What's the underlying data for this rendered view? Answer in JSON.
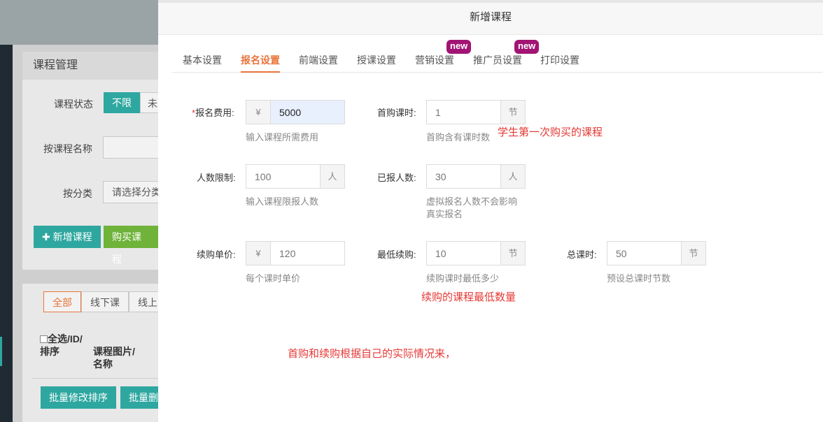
{
  "background": {
    "panel_title": "课程管理",
    "course_status_label": "课程状态",
    "status_options": [
      "不限",
      "未"
    ],
    "name_filter_label": "按课程名称",
    "category_label": "按分类",
    "category_placeholder": "请选择分类",
    "add_course_label": "新增课程",
    "buy_course_label": "购买课程",
    "type_tabs": [
      "全部",
      "线下课",
      "线上"
    ],
    "table_header_col1": "全选/ID/排序",
    "table_header_col2": "课程图片/名称",
    "batch_sort_label": "批量修改排序",
    "batch_delete_label": "批量删"
  },
  "modal": {
    "title": "新增课程",
    "tabs": [
      {
        "label": "基本设置"
      },
      {
        "label": "报名设置",
        "active": true
      },
      {
        "label": "前端设置"
      },
      {
        "label": "授课设置"
      },
      {
        "label": "营销设置",
        "badge": "new"
      },
      {
        "label": "推广员设置",
        "badge": "new"
      },
      {
        "label": "打印设置"
      }
    ],
    "fields": {
      "fee": {
        "required_mark": "*",
        "label": "报名费用:",
        "prefix": "¥",
        "value": "5000",
        "hint": "输入课程所需费用"
      },
      "first_lessons": {
        "label": "首购课时:",
        "value": "1",
        "suffix": "节",
        "hint": "首购含有课时数"
      },
      "limit": {
        "label": "人数限制:",
        "value": "100",
        "suffix": "人",
        "hint": "输入课程限报人数"
      },
      "enrolled": {
        "label": "已报人数:",
        "value": "30",
        "suffix": "人",
        "hint": "虚拟报名人数不会影响真实报名"
      },
      "renew_price": {
        "label": "续购单价:",
        "prefix": "¥",
        "value": "120",
        "hint": "每个课时单价"
      },
      "min_renew": {
        "label": "最低续购:",
        "value": "10",
        "suffix": "节",
        "hint": "续购课时最低多少"
      },
      "total_lessons": {
        "label": "总课时:",
        "value": "50",
        "suffix": "节",
        "hint": "预设总课时节数"
      }
    },
    "notes": {
      "first_purchase": "学生第一次购买的课程",
      "min_renew": "续购的课程最低数量",
      "summary": "首购和续购根据自己的实际情况来，"
    }
  },
  "colors": {
    "accent": "#e8743b",
    "teal": "#2ea7a0",
    "green": "#6fb33a",
    "badge": "#a21474",
    "annotation": "#e53935"
  }
}
